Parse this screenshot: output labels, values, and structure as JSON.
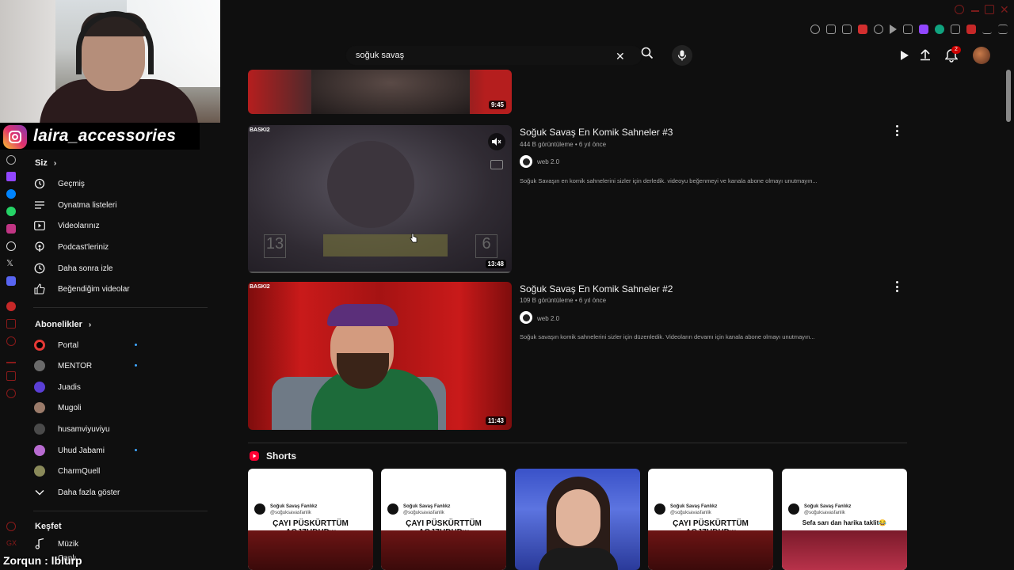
{
  "browser": {
    "extensions": [
      "emoji-icon",
      "bookmark-icon",
      "screenshot-icon",
      "shield-red-icon",
      "heart-icon",
      "play-icon",
      "grid-icon",
      "twitch-ext-icon",
      "green-ext-icon",
      "puzzle-icon",
      "adblock-icon",
      "download-icon",
      "menu-icon"
    ]
  },
  "stream_overlay": {
    "brand_handle": "laira_accessories",
    "bottom_text": "Zorqun : lblurp"
  },
  "header": {
    "search": {
      "value": "soğuk savaş"
    },
    "notifications_count": "2"
  },
  "sidebar": {
    "you_section": {
      "title": "Siz"
    },
    "you_items": [
      {
        "label": "Geçmiş",
        "icon": "history-icon"
      },
      {
        "label": "Oynatma listeleri",
        "icon": "playlist-icon"
      },
      {
        "label": "Videolarınız",
        "icon": "your-videos-icon"
      },
      {
        "label": "Podcast'leriniz",
        "icon": "podcast-icon"
      },
      {
        "label": "Daha sonra izle",
        "icon": "clock-icon"
      },
      {
        "label": "Beğendiğim videolar",
        "icon": "thumbs-up-icon"
      }
    ],
    "subs_section": {
      "title": "Abonelikler"
    },
    "subscriptions": [
      {
        "label": "Portal",
        "color": "#e53935",
        "new": true
      },
      {
        "label": "MENTOR",
        "color": "#6a6a6a",
        "new": true
      },
      {
        "label": "Juadis",
        "color": "#5b3fd6",
        "new": false
      },
      {
        "label": "Mugoli",
        "color": "#9b7b6a",
        "new": false
      },
      {
        "label": "husamviyuviyu",
        "color": "#4a4a4a",
        "new": false
      },
      {
        "label": "Uhud Jabami",
        "color": "#b86bd1",
        "new": true
      },
      {
        "label": "CharmQuell",
        "color": "#8a8a5a",
        "new": false
      }
    ],
    "show_more": "Daha fazla göster",
    "explore_section": {
      "title": "Keşfet"
    },
    "explore_items": [
      {
        "label": "Müzik",
        "icon": "music-icon"
      },
      {
        "label": "Canlı",
        "icon": "live-icon"
      }
    ]
  },
  "videos": [
    {
      "duration": "9:45"
    },
    {
      "title": "Soğuk Savaş En Komik Sahneler #3",
      "meta": "444 B görüntüleme • 6 yıl önce",
      "channel": "web 2.0",
      "description": "Soğuk Savaşın en komik sahnelerini sizler için derledik. videoyu beğenmeyi ve kanala abone olmayı unutmayın...",
      "duration": "13:48",
      "badge": "BASKI2"
    },
    {
      "title": "Soğuk Savaş En Komik Sahneler #2",
      "meta": "109 B görüntüleme • 6 yıl önce",
      "channel": "web 2.0",
      "description": "Soğuk savaşın komik sahnelerini sizler için düzenledik. Videoların devamı için kanala abone olmayı unutmayın...",
      "duration": "11:43",
      "badge": "BASKI2"
    }
  ],
  "shorts": {
    "title": "Shorts",
    "items": [
      {
        "channel": "Soğuk Savaş Fanlıkz",
        "handle": "@soğuksavasfanlik",
        "caption": "ÇAYI PÜSKÜRTTÜM AQJZHDHDw"
      },
      {
        "channel": "Soğuk Savaş Fanlıkz",
        "handle": "@soğuksavasfanlik",
        "caption": "ÇAYI PÜSKÜRTTÜM AQJZHDHDw"
      },
      {
        "channel": "",
        "handle": "",
        "caption": ""
      },
      {
        "channel": "Soğuk Savaş Fanlıkz",
        "handle": "@soğuksavasfanlik",
        "caption": "ÇAYI PÜSKÜRTTÜM AQJZHDHDw"
      },
      {
        "channel": "Soğuk Savaş Fanlıkz",
        "handle": "@soğuksavasfanlik",
        "caption": "Sefa sarı dan harika taklit😂"
      }
    ]
  }
}
